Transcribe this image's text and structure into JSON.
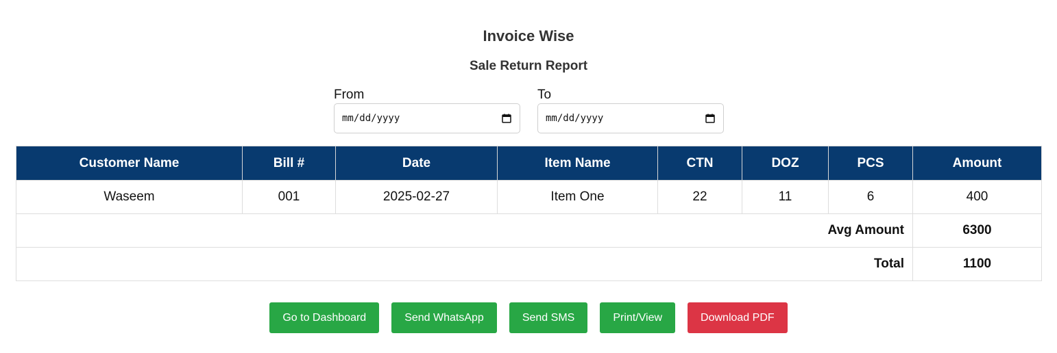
{
  "header": {
    "title": "Invoice Wise",
    "subtitle": "Sale Return Report"
  },
  "filters": {
    "from_label": "From",
    "from_value": "mm/dd/yyyy",
    "to_label": "To",
    "to_value": "mm/dd/yyyy"
  },
  "table": {
    "columns": [
      "Customer Name",
      "Bill #",
      "Date",
      "Item Name",
      "CTN",
      "DOZ",
      "PCS",
      "Amount"
    ],
    "rows": [
      [
        "Waseem",
        "001",
        "2025-02-27",
        "Item One",
        "22",
        "11",
        "6",
        "400"
      ]
    ],
    "avg_label": "Avg Amount",
    "avg_value": "6300",
    "total_label": "Total",
    "total_value": "1100"
  },
  "actions": {
    "dashboard": "Go to Dashboard",
    "whatsapp": "Send WhatsApp",
    "sms": "Send SMS",
    "print": "Print/View",
    "pdf": "Download PDF"
  },
  "colors": {
    "header_bg": "#083a6f",
    "button_green": "#28a745",
    "button_red": "#dc3545"
  },
  "icons": {
    "date_picker": "calendar-icon"
  }
}
